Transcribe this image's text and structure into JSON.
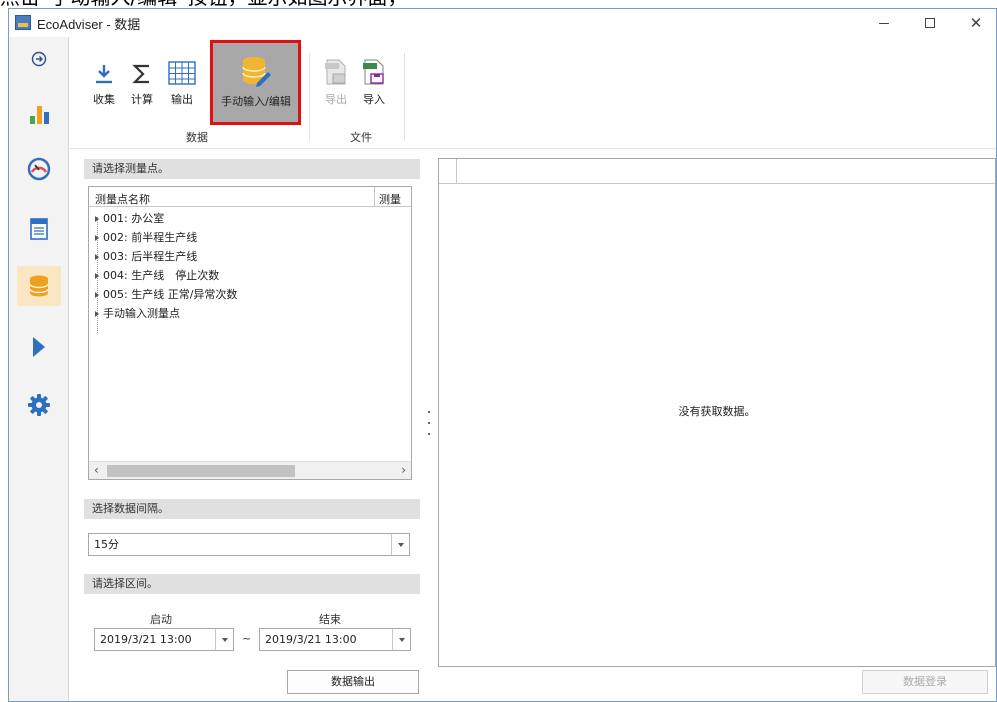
{
  "caption": "点击“手动输入/编辑”按钮，显示如图示界面，",
  "window": {
    "title": "EcoAdviser - 数据",
    "min_icon": "minimize-icon",
    "max_icon": "maximize-icon",
    "close_icon": "close-icon"
  },
  "nav": [
    {
      "name": "nav-expand",
      "icon": "expand-arrow-icon"
    },
    {
      "name": "nav-graph",
      "icon": "bar-chart-icon"
    },
    {
      "name": "nav-monitor",
      "icon": "gauge-icon"
    },
    {
      "name": "nav-report",
      "icon": "report-icon"
    },
    {
      "name": "nav-data",
      "icon": "database-icon",
      "active": true
    },
    {
      "name": "nav-play",
      "icon": "play-icon"
    },
    {
      "name": "nav-settings",
      "icon": "gear-icon"
    }
  ],
  "ribbon": {
    "collect": "收集",
    "calculate": "计算",
    "output": "输出",
    "manual_edit": "手动输入/编辑",
    "export": "导出",
    "import": "导入",
    "group_data": "数据",
    "group_file": "文件"
  },
  "points": {
    "header": "请选择测量点。",
    "col_name": "测量点名称",
    "col_second": "测量",
    "items": [
      "001: 办公室",
      "002: 前半程生产线",
      "003: 后半程生产线",
      "004: 生产线　停止次数",
      "005: 生产线 正常/异常次数",
      "手动输入测量点"
    ]
  },
  "interval": {
    "header": "选择数据间隔。",
    "value": "15分"
  },
  "range": {
    "header": "请选择区间。",
    "start_label": "启动",
    "end_label": "结束",
    "start_value": "2019/3/21 13:00",
    "end_value": "2019/3/21 13:00",
    "tilde": "~"
  },
  "buttons": {
    "data_output": "数据输出",
    "data_register": "数据登录"
  },
  "grid": {
    "empty_message": "没有获取数据。"
  },
  "colors": {
    "highlight_border": "#e01010",
    "active_nav": "#fbe6c4",
    "accent_blue": "#2f6fc0",
    "accent_orange": "#e8a030"
  }
}
